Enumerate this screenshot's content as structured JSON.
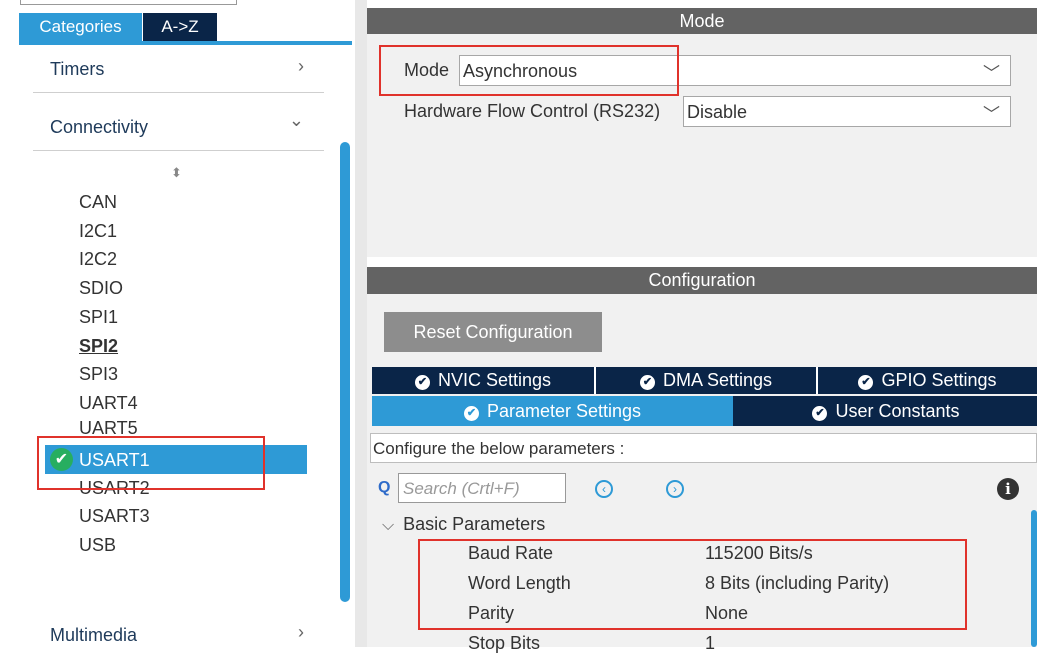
{
  "category_tabs": {
    "categories": "Categories",
    "az": "A->Z"
  },
  "groups": {
    "timers": "Timers",
    "connectivity": "Connectivity",
    "multimedia": "Multimedia",
    "collapsed_chevron": "›",
    "expanded_chevron": "⌄"
  },
  "peripherals": [
    "CAN",
    "I2C1",
    "I2C2",
    "SDIO",
    "SPI1",
    "SPI2",
    "SPI3",
    "UART4",
    "UART5",
    "USART1",
    "USART2",
    "USART3",
    "USB"
  ],
  "selected_peripheral": "USART1",
  "mode_section": {
    "header": "Mode",
    "mode_label": "Mode",
    "mode_value": "Asynchronous",
    "flow_label": "Hardware Flow Control (RS232)",
    "flow_value": "Disable"
  },
  "config_section": {
    "header": "Configuration",
    "reset_button": "Reset Configuration",
    "tabs_row1": [
      "NVIC Settings",
      "DMA Settings",
      "GPIO Settings"
    ],
    "tabs_row2": [
      "Parameter Settings",
      "User Constants"
    ],
    "active_tab": "Parameter Settings",
    "configure_text": "Configure the below parameters :",
    "search_placeholder": "Search (Crtl+F)",
    "basic_params_title": "Basic Parameters",
    "params": [
      {
        "name": "Baud Rate",
        "value": "115200 Bits/s"
      },
      {
        "name": "Word Length",
        "value": "8 Bits (including Parity)"
      },
      {
        "name": "Parity",
        "value": "None"
      },
      {
        "name": "Stop Bits",
        "value": "1"
      }
    ]
  },
  "icons": {
    "check": "✔",
    "dropdown": "﹀",
    "search": "Q",
    "prev": "‹",
    "next": "›",
    "info": "i",
    "sort": "⬍",
    "collapse": "⌵"
  },
  "colors": {
    "accent": "#2e9ad6",
    "dark_navy": "#0a2548",
    "header_gray": "#636363",
    "highlight_red": "#e0322b",
    "check_green": "#27ae60"
  }
}
